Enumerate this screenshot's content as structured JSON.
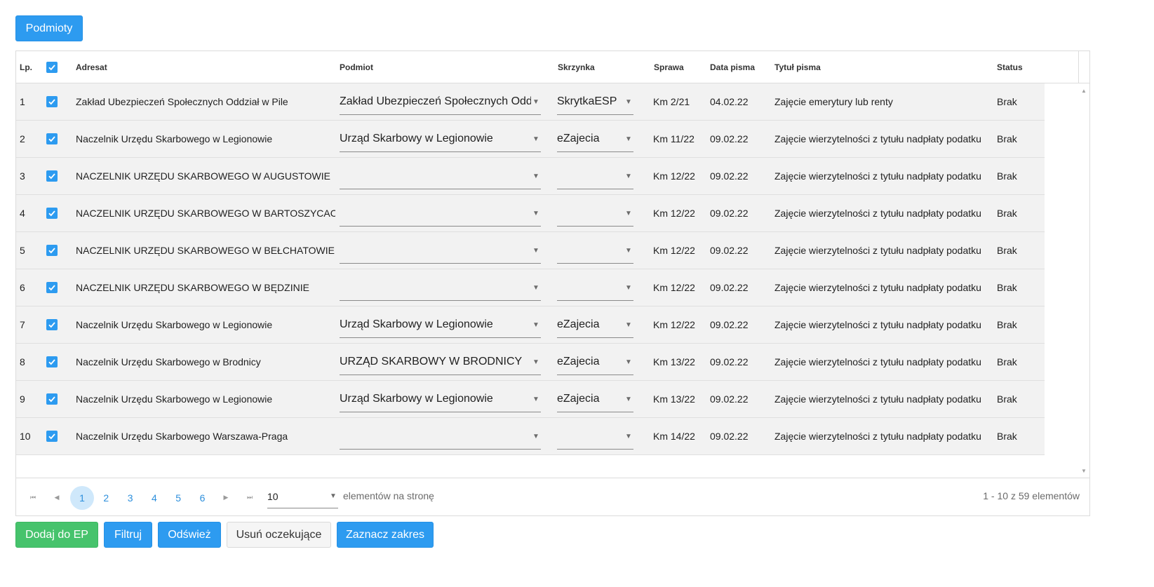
{
  "top_button": "Podmioty",
  "columns": {
    "lp": "Lp.",
    "adresat": "Adresat",
    "podmiot": "Podmiot",
    "skrzynka": "Skrzynka",
    "sprawa": "Sprawa",
    "data_pisma": "Data pisma",
    "tytul_pisma": "Tytuł pisma",
    "status": "Status"
  },
  "header_checkbox_checked": true,
  "rows": [
    {
      "lp": "1",
      "checked": true,
      "adresat": "Zakład Ubezpieczeń Społecznych Oddział w Pile",
      "podmiot": "Zakład Ubezpieczeń Społecznych Oddz",
      "skrzynka": "SkrytkaESP",
      "sprawa": "Km 2/21",
      "data": "04.02.22",
      "tytul": "Zajęcie emerytury lub renty",
      "status": "Brak"
    },
    {
      "lp": "2",
      "checked": true,
      "adresat": "Naczelnik Urzędu Skarbowego w Legionowie",
      "podmiot": "Urząd Skarbowy w Legionowie",
      "skrzynka": "eZajecia",
      "sprawa": "Km 11/22",
      "data": "09.02.22",
      "tytul": "Zajęcie wierzytelności z tytułu nadpłaty podatku",
      "status": "Brak"
    },
    {
      "lp": "3",
      "checked": true,
      "adresat": "NACZELNIK URZĘDU SKARBOWEGO W AUGUSTOWIE",
      "podmiot": "",
      "skrzynka": "",
      "sprawa": "Km 12/22",
      "data": "09.02.22",
      "tytul": "Zajęcie wierzytelności z tytułu nadpłaty podatku",
      "status": "Brak"
    },
    {
      "lp": "4",
      "checked": true,
      "adresat": "NACZELNIK URZĘDU SKARBOWEGO W BARTOSZYCACH",
      "podmiot": "",
      "skrzynka": "",
      "sprawa": "Km 12/22",
      "data": "09.02.22",
      "tytul": "Zajęcie wierzytelności z tytułu nadpłaty podatku",
      "status": "Brak"
    },
    {
      "lp": "5",
      "checked": true,
      "adresat": "NACZELNIK URZĘDU SKARBOWEGO W BEŁCHATOWIE",
      "podmiot": "",
      "skrzynka": "",
      "sprawa": "Km 12/22",
      "data": "09.02.22",
      "tytul": "Zajęcie wierzytelności z tytułu nadpłaty podatku",
      "status": "Brak"
    },
    {
      "lp": "6",
      "checked": true,
      "adresat": "NACZELNIK URZĘDU SKARBOWEGO W BĘDZINIE",
      "podmiot": "",
      "skrzynka": "",
      "sprawa": "Km 12/22",
      "data": "09.02.22",
      "tytul": "Zajęcie wierzytelności z tytułu nadpłaty podatku",
      "status": "Brak"
    },
    {
      "lp": "7",
      "checked": true,
      "adresat": "Naczelnik Urzędu Skarbowego w Legionowie",
      "podmiot": "Urząd Skarbowy w Legionowie",
      "skrzynka": "eZajecia",
      "sprawa": "Km 12/22",
      "data": "09.02.22",
      "tytul": "Zajęcie wierzytelności z tytułu nadpłaty podatku",
      "status": "Brak"
    },
    {
      "lp": "8",
      "checked": true,
      "adresat": "Naczelnik Urzędu Skarbowego w Brodnicy",
      "podmiot": "URZĄD SKARBOWY W BRODNICY",
      "skrzynka": "eZajecia",
      "sprawa": "Km 13/22",
      "data": "09.02.22",
      "tytul": "Zajęcie wierzytelności z tytułu nadpłaty podatku",
      "status": "Brak"
    },
    {
      "lp": "9",
      "checked": true,
      "adresat": "Naczelnik Urzędu Skarbowego w Legionowie",
      "podmiot": "Urząd Skarbowy w Legionowie",
      "skrzynka": "eZajecia",
      "sprawa": "Km 13/22",
      "data": "09.02.22",
      "tytul": "Zajęcie wierzytelności z tytułu nadpłaty podatku",
      "status": "Brak"
    },
    {
      "lp": "10",
      "checked": true,
      "adresat": "Naczelnik Urzędu Skarbowego Warszawa-Praga",
      "podmiot": "",
      "skrzynka": "",
      "sprawa": "Km 14/22",
      "data": "09.02.22",
      "tytul": "Zajęcie wierzytelności z tytułu nadpłaty podatku",
      "status": "Brak"
    }
  ],
  "pager": {
    "pages": [
      "1",
      "2",
      "3",
      "4",
      "5",
      "6"
    ],
    "current_page": "1",
    "page_size": "10",
    "page_size_label": "elementów na stronę",
    "info": "1 - 10 z 59 elementów"
  },
  "bottom_buttons": {
    "add": "Dodaj do EP",
    "filter": "Filtruj",
    "refresh": "Odśwież",
    "remove_pending": "Usuń oczekujące",
    "select_range": "Zaznacz zakres"
  },
  "colors": {
    "primary": "#2d9bf0",
    "success": "#46c36c",
    "row_bg": "#f2f2f2",
    "active_page_bg": "#cfe8fb"
  }
}
